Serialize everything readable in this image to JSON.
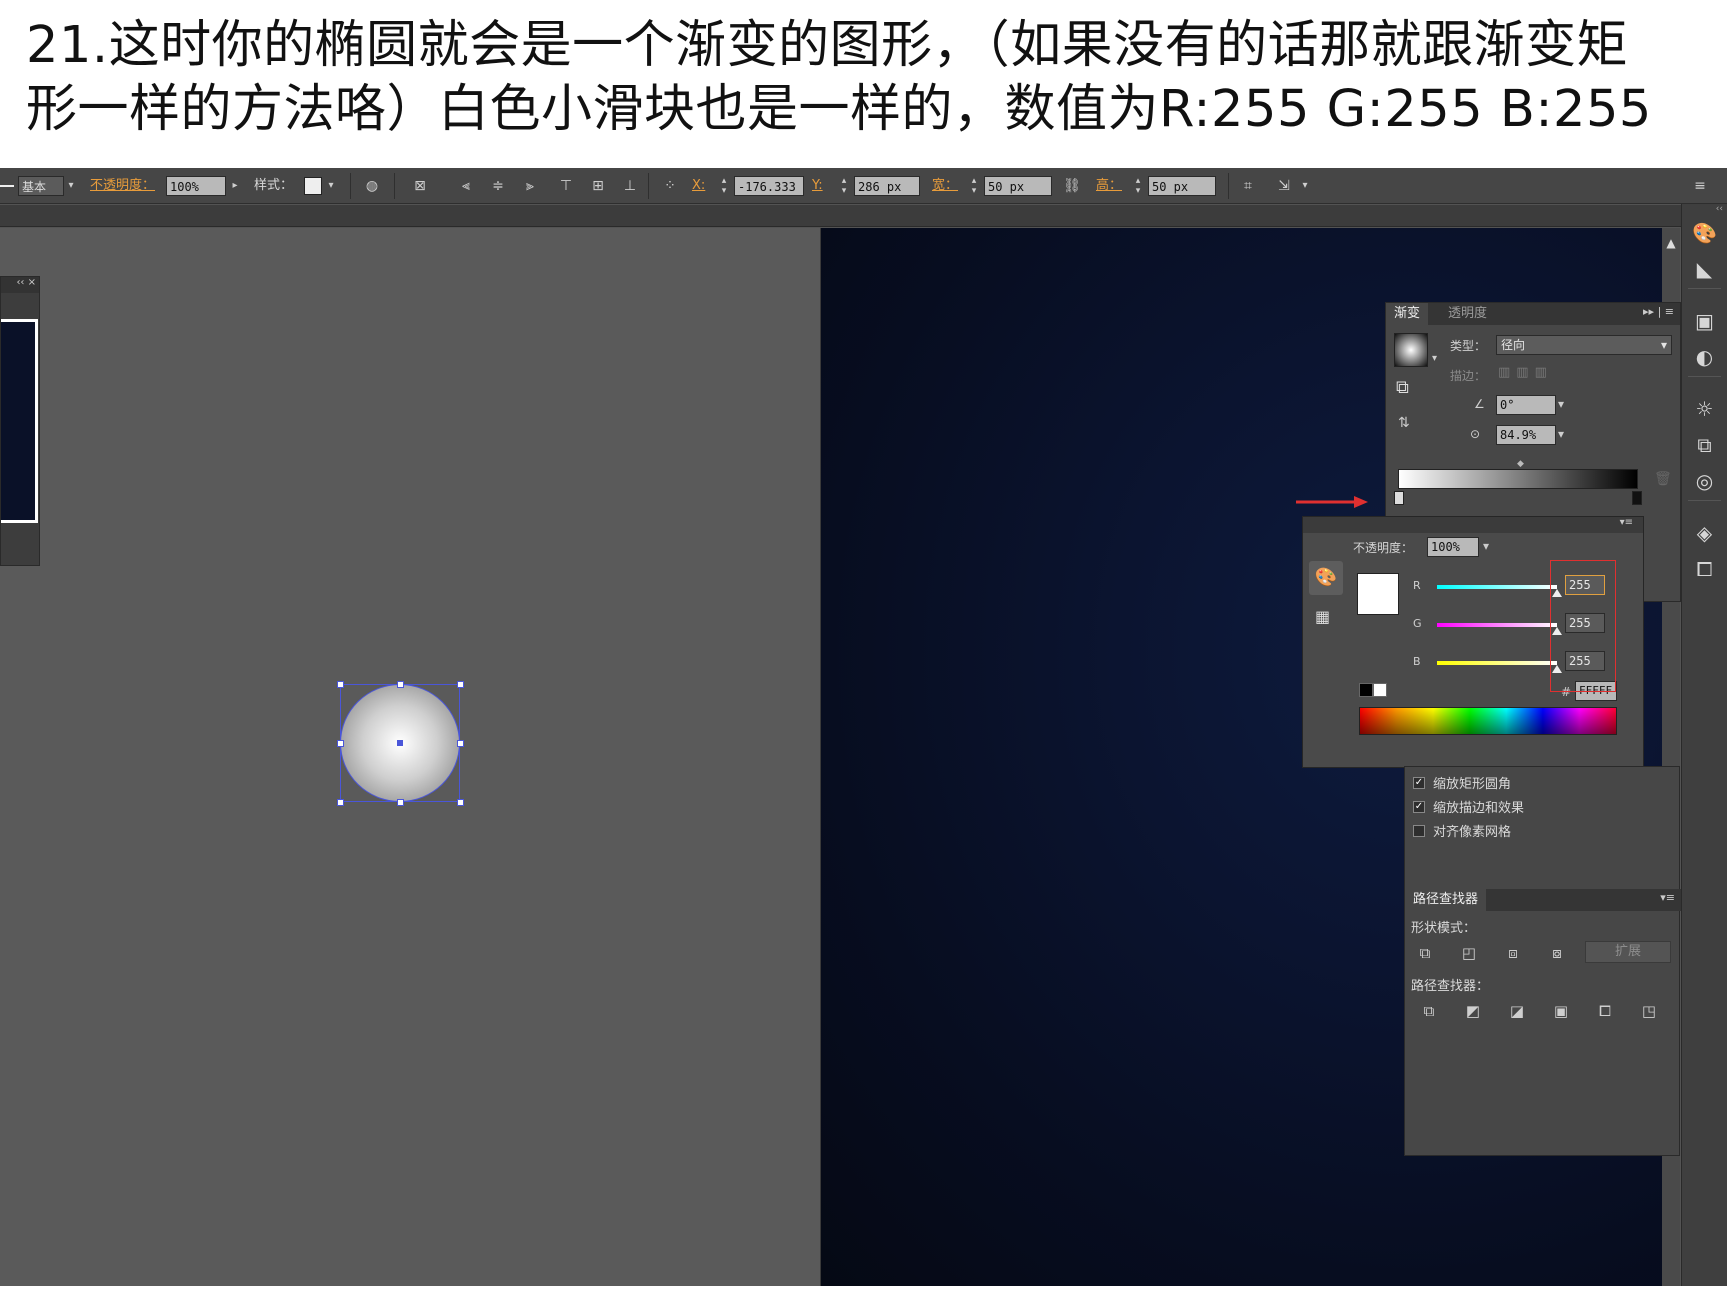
{
  "caption": {
    "line1": "21.这时你的椭圆就会是一个渐变的图形，（如果没有的话那就跟渐变矩",
    "line2": "形一样的方法咯）白色小滑块也是一样的，数值为R:255  G:255  B:255"
  },
  "control_bar": {
    "stroke_style": "基本",
    "opacity_label": "不透明度：",
    "opacity_value": "100%",
    "style_label": "样式：",
    "x_label": "X:",
    "x_value": "-176.333",
    "y_label": "Y:",
    "y_value": "286 px",
    "w_label": "宽：",
    "w_value": "50 px",
    "h_label": "高：",
    "h_value": "50 px"
  },
  "gradient_panel": {
    "tab_active": "渐变",
    "tab_inactive": "透明度",
    "type_label": "类型：",
    "type_value": "径向",
    "stroke_label": "描边：",
    "angle_value": "0°",
    "aspect_value": "84.9%",
    "gradient_stops": [
      "#ffffff",
      "#000000"
    ]
  },
  "color_panel": {
    "opacity_label": "不透明度：",
    "opacity_value": "100%",
    "r_label": "R",
    "g_label": "G",
    "b_label": "B",
    "r_value": "255",
    "g_value": "255",
    "b_value": "255",
    "hex_label": "#",
    "hex_value": "FFFFF",
    "swatch_color": "#ffffff"
  },
  "transform_options": {
    "scale_corners": "缩放矩形圆角",
    "scale_strokes": "缩放描边和效果",
    "align_pixel": "对齐像素网格",
    "scale_corners_checked": true,
    "scale_strokes_checked": true,
    "align_pixel_checked": false
  },
  "pathfinder": {
    "tab": "路径查找器",
    "shape_modes_label": "形状模式：",
    "expand_label": "扩展",
    "pathfinders_label": "路径查找器："
  },
  "colors": {
    "app_bg": "#535353",
    "artboard_dark": "#0b1430",
    "selection": "#4a56d9",
    "annotation_red": "#e03030"
  }
}
